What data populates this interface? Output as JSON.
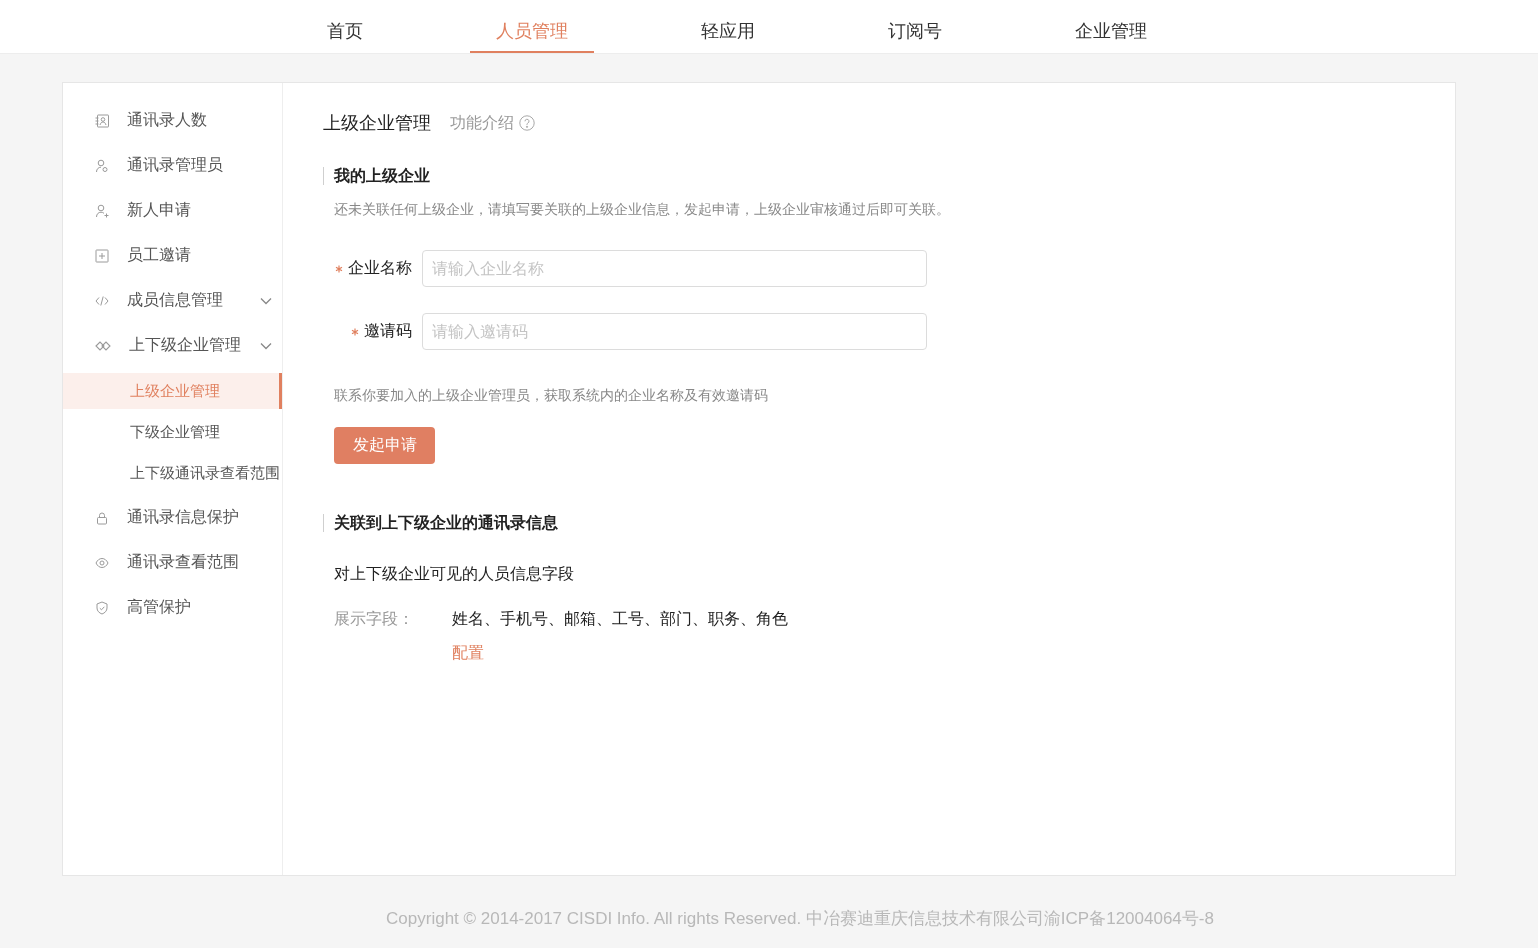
{
  "nav": {
    "tabs": [
      {
        "label": "首页",
        "selected": false
      },
      {
        "label": "人员管理",
        "selected": true
      },
      {
        "label": "轻应用",
        "selected": false
      },
      {
        "label": "订阅号",
        "selected": false
      },
      {
        "label": "企业管理",
        "selected": false
      }
    ]
  },
  "sidebar": {
    "items": [
      {
        "label": "通讯录人数",
        "kind": "link",
        "selected": false
      },
      {
        "label": "通讯录管理员",
        "kind": "link",
        "selected": false
      },
      {
        "label": "新人申请",
        "kind": "link",
        "selected": false
      },
      {
        "label": "员工邀请",
        "kind": "link",
        "selected": false
      },
      {
        "label": "成员信息管理",
        "kind": "group",
        "selected": false
      },
      {
        "label": "上下级企业管理",
        "kind": "group",
        "selected": false,
        "children": [
          {
            "label": "上级企业管理",
            "selected": true
          },
          {
            "label": "下级企业管理",
            "selected": false
          },
          {
            "label": "上下级通讯录查看范围",
            "selected": false
          }
        ]
      },
      {
        "label": "通讯录信息保护",
        "kind": "link",
        "selected": false
      },
      {
        "label": "通讯录查看范围",
        "kind": "link",
        "selected": false
      },
      {
        "label": "高管保护",
        "kind": "link",
        "selected": false
      }
    ]
  },
  "content": {
    "title": "上级企业管理",
    "intro_link": "功能介绍",
    "parent_section": {
      "heading": "我的上级企业",
      "description": "还未关联任何上级企业，请填写要关联的上级企业信息，发起申请，上级企业审核通过后即可关联。",
      "fields": [
        {
          "label": "企业名称",
          "required": true,
          "placeholder": "请输入企业名称"
        },
        {
          "label": "邀请码",
          "required": true,
          "placeholder": "请输入邀请码"
        }
      ],
      "hint": "联系你要加入的上级企业管理员，获取系统内的企业名称及有效邀请码",
      "submit_button": "发起申请"
    },
    "directory_section": {
      "heading": "关联到上下级企业的通讯录信息",
      "subtitle": "对上下级企业可见的人员信息字段",
      "display_label": "展示字段：",
      "display_value": "姓名、手机号、邮箱、工号、部门、职务、角色",
      "config_link": "配置"
    }
  },
  "footer": {
    "copyright": "Copyright © 2014-2017 CISDI Info. All rights Reserved. 中冶赛迪重庆信息技术有限公司渝ICP备12004064号-8"
  }
}
